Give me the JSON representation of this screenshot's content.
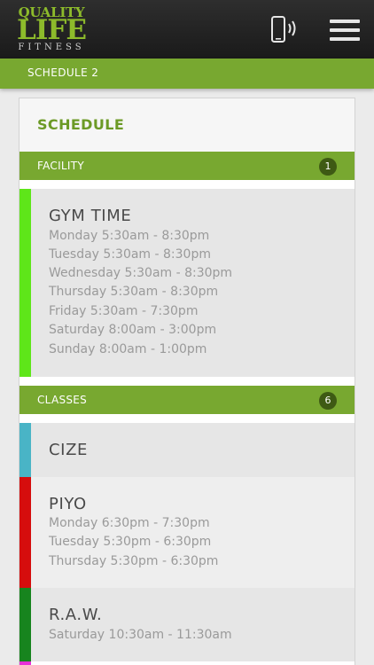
{
  "app": {
    "logo": {
      "line1": "QUALITY",
      "line2": "LIFE",
      "line3": "FITNESS"
    },
    "icons": {
      "phone": "phone-vibrate-icon",
      "menu": "hamburger-menu-icon"
    },
    "colors": {
      "brand_green": "#78a830",
      "title_green": "#6c9a26",
      "header_dark": "#1f1f1f"
    }
  },
  "subheader": {
    "title": "SCHEDULE  2"
  },
  "card": {
    "title": "SCHEDULE"
  },
  "facility": {
    "label": "FACILITY",
    "count": "1",
    "entries": [
      {
        "name": "GYM TIME",
        "color": "#5ee619",
        "lines": [
          "Monday  5:30am - 8:30pm",
          "Tuesday  5:30am - 8:30pm",
          "Wednesday  5:30am - 8:30pm",
          "Thursday  5:30am - 8:30pm",
          "Friday  5:30am - 7:30pm",
          "Saturday  8:00am - 3:00pm",
          "Sunday  8:00am - 1:00pm"
        ]
      }
    ]
  },
  "classes": {
    "label": "CLASSES",
    "count": "6",
    "entries": [
      {
        "name": "CIZE",
        "color": "#49b4c6",
        "lines": []
      },
      {
        "name": "PIYO",
        "color": "#d60d0d",
        "lines": [
          "Monday  6:30pm - 7:30pm",
          "Tuesday  5:30pm - 6:30pm",
          "Thursday  5:30pm - 6:30pm"
        ]
      },
      {
        "name": "R.A.W.",
        "color": "#17841e",
        "lines": [
          "Saturday  10:30am - 11:30am"
        ]
      }
    ]
  }
}
